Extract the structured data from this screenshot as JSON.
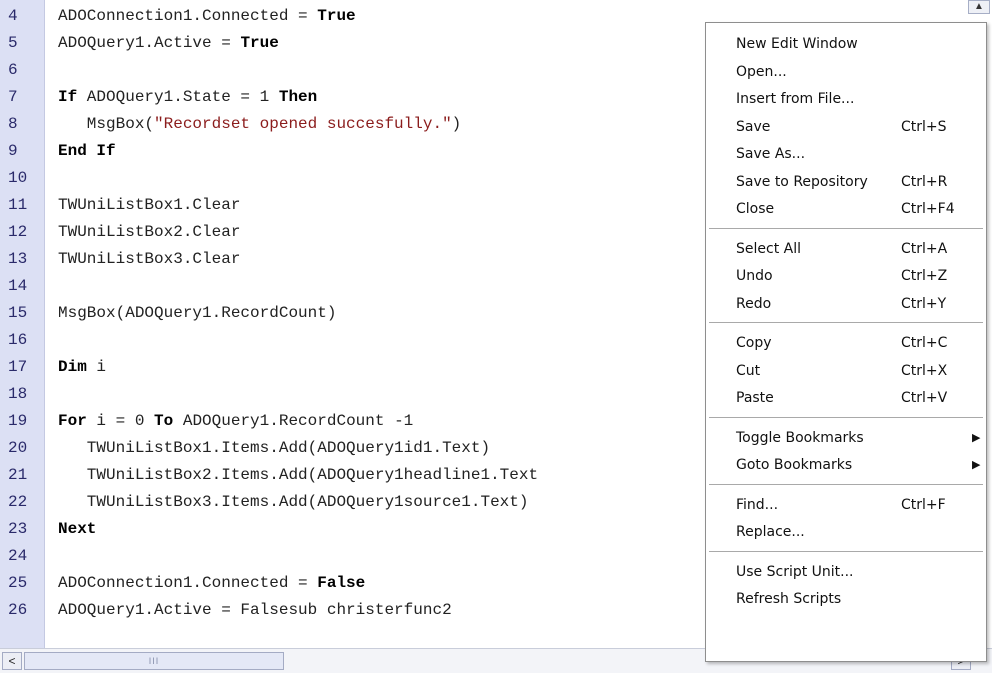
{
  "editor": {
    "lines": [
      {
        "num": "4",
        "parts": [
          [
            "t",
            "ADOConnection1.Connected = "
          ],
          [
            "kw",
            "True"
          ]
        ]
      },
      {
        "num": "5",
        "parts": [
          [
            "t",
            "ADOQuery1.Active = "
          ],
          [
            "kw",
            "True"
          ]
        ]
      },
      {
        "num": "6",
        "parts": []
      },
      {
        "num": "7",
        "parts": [
          [
            "kw",
            "If"
          ],
          [
            "t",
            " ADOQuery1.State = 1 "
          ],
          [
            "kw",
            "Then"
          ]
        ]
      },
      {
        "num": "8",
        "parts": [
          [
            "t",
            "   MsgBox("
          ],
          [
            "str",
            "\"Recordset opened succesfully.\""
          ],
          [
            "t",
            ")"
          ]
        ]
      },
      {
        "num": "9",
        "parts": [
          [
            "kw",
            "End If"
          ]
        ]
      },
      {
        "num": "10",
        "parts": []
      },
      {
        "num": "11",
        "parts": [
          [
            "t",
            "TWUniListBox1.Clear"
          ]
        ]
      },
      {
        "num": "12",
        "parts": [
          [
            "t",
            "TWUniListBox2.Clear"
          ]
        ]
      },
      {
        "num": "13",
        "parts": [
          [
            "t",
            "TWUniListBox3.Clear"
          ]
        ]
      },
      {
        "num": "14",
        "parts": []
      },
      {
        "num": "15",
        "parts": [
          [
            "t",
            "MsgBox(ADOQuery1.RecordCount)"
          ]
        ]
      },
      {
        "num": "16",
        "parts": []
      },
      {
        "num": "17",
        "parts": [
          [
            "kw",
            "Dim"
          ],
          [
            "t",
            " i"
          ]
        ]
      },
      {
        "num": "18",
        "parts": []
      },
      {
        "num": "19",
        "parts": [
          [
            "kw",
            "For"
          ],
          [
            "t",
            " i = 0 "
          ],
          [
            "kw",
            "To"
          ],
          [
            "t",
            " ADOQuery1.RecordCount -1"
          ]
        ]
      },
      {
        "num": "20",
        "parts": [
          [
            "t",
            "   TWUniListBox1.Items.Add(ADOQuery1id1.Text)"
          ]
        ]
      },
      {
        "num": "21",
        "parts": [
          [
            "t",
            "   TWUniListBox2.Items.Add(ADOQuery1headline1.Text"
          ]
        ]
      },
      {
        "num": "22",
        "parts": [
          [
            "t",
            "   TWUniListBox3.Items.Add(ADOQuery1source1.Text)"
          ]
        ]
      },
      {
        "num": "23",
        "parts": [
          [
            "kw",
            "Next"
          ]
        ]
      },
      {
        "num": "24",
        "parts": []
      },
      {
        "num": "25",
        "parts": [
          [
            "t",
            "ADOConnection1.Connected = "
          ],
          [
            "kw",
            "False"
          ]
        ]
      },
      {
        "num": "26",
        "parts": [
          [
            "t",
            "ADOQuery1.Active = Falsesub christerfunc2"
          ]
        ]
      }
    ]
  },
  "scrollbar": {
    "left_arrow": "<",
    "right_arrow": ">",
    "thumb_grip": "III"
  },
  "context_menu": {
    "groups": [
      [
        {
          "label": "New Edit Window",
          "shortcut": ""
        },
        {
          "label": "Open...",
          "shortcut": ""
        },
        {
          "label": "Insert from File...",
          "shortcut": ""
        },
        {
          "label": "Save",
          "shortcut": "Ctrl+S"
        },
        {
          "label": "Save As...",
          "shortcut": ""
        },
        {
          "label": "Save to Repository",
          "shortcut": "Ctrl+R"
        },
        {
          "label": "Close",
          "shortcut": "Ctrl+F4"
        }
      ],
      [
        {
          "label": "Select All",
          "shortcut": "Ctrl+A"
        },
        {
          "label": "Undo",
          "shortcut": "Ctrl+Z"
        },
        {
          "label": "Redo",
          "shortcut": "Ctrl+Y"
        }
      ],
      [
        {
          "label": "Copy",
          "shortcut": "Ctrl+C"
        },
        {
          "label": "Cut",
          "shortcut": "Ctrl+X"
        },
        {
          "label": "Paste",
          "shortcut": "Ctrl+V"
        }
      ],
      [
        {
          "label": "Toggle Bookmarks",
          "shortcut": "",
          "submenu": true
        },
        {
          "label": "Goto Bookmarks",
          "shortcut": "",
          "submenu": true
        }
      ],
      [
        {
          "label": "Find...",
          "shortcut": "Ctrl+F"
        },
        {
          "label": "Replace...",
          "shortcut": ""
        }
      ],
      [
        {
          "label": "Use Script Unit...",
          "shortcut": ""
        },
        {
          "label": "Refresh Scripts",
          "shortcut": ""
        }
      ]
    ]
  },
  "icons": {
    "submenu_arrow": "▶",
    "scroll_up": "▲"
  }
}
